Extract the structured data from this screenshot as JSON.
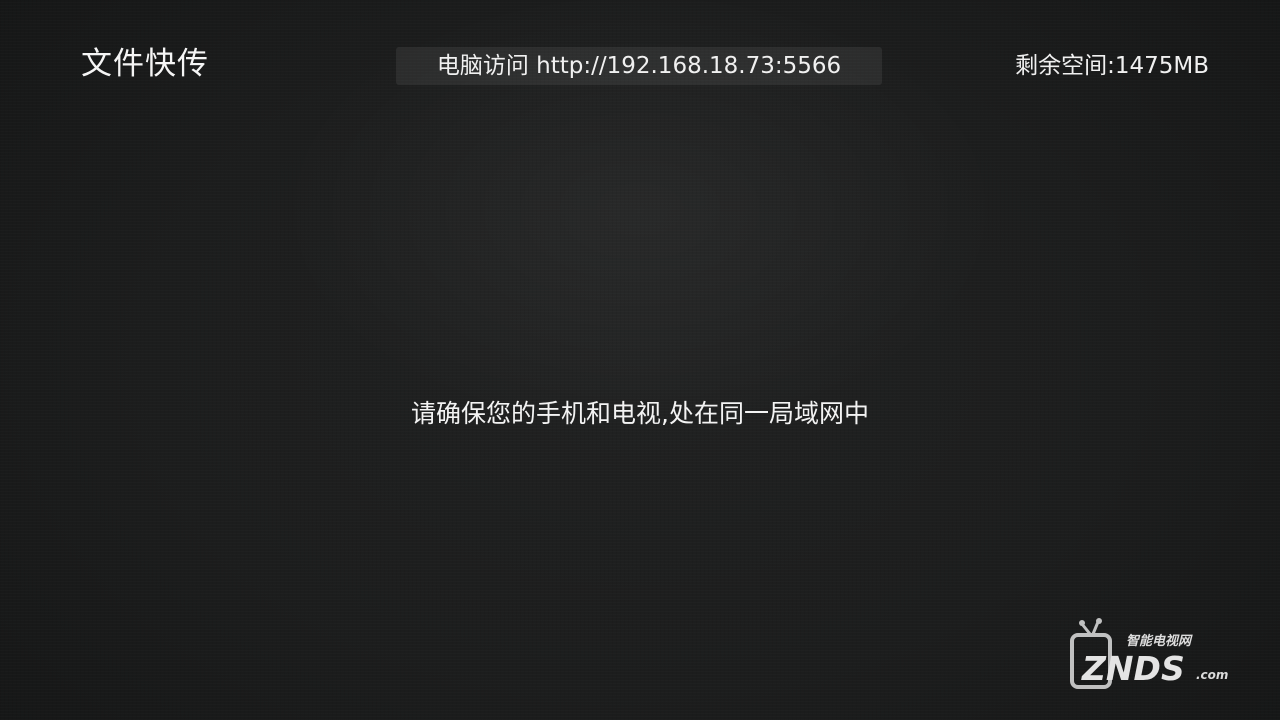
{
  "header": {
    "title": "文件快传",
    "access_label": "电脑访问 http://192.168.18.73:5566",
    "storage_label": "剩余空间:1475MB"
  },
  "main": {
    "hint": "请确保您的手机和电视,处在同一局域网中"
  },
  "watermark": {
    "logo_text": "ZNDS",
    "logo_suffix": ".com",
    "logo_tagline": "智能电视网"
  },
  "colors": {
    "background": "#1b1c1c",
    "text": "#f2f2f2"
  }
}
